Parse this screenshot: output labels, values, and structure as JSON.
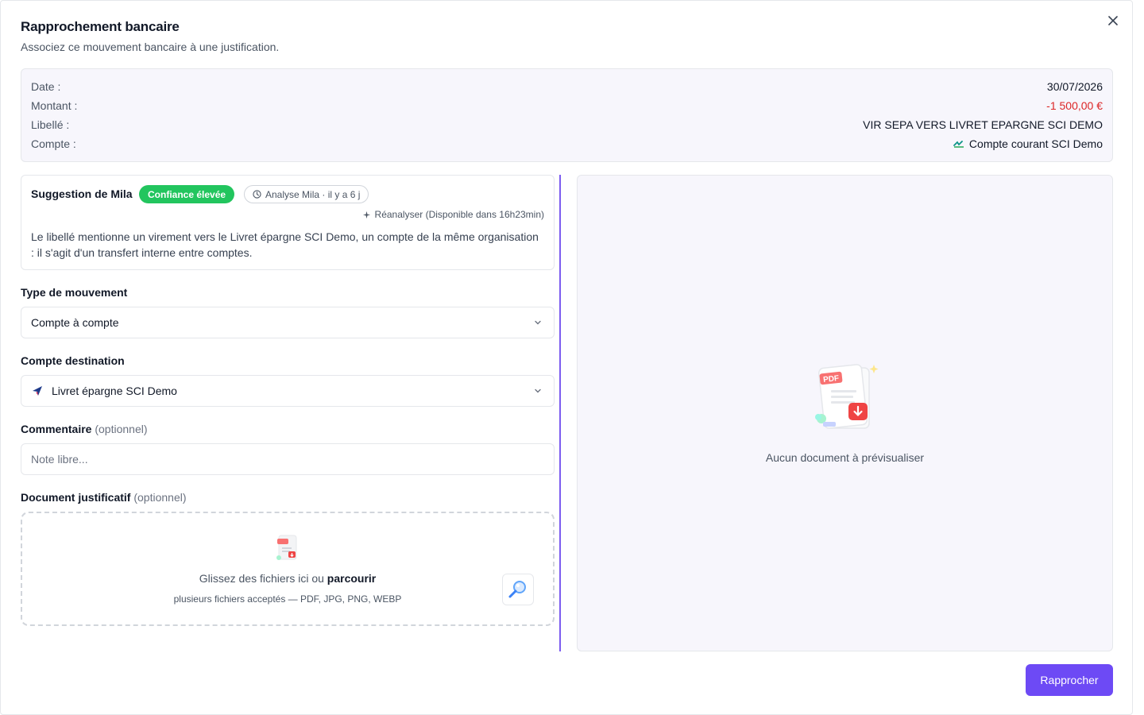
{
  "dialog": {
    "title": "Rapprochement bancaire",
    "subtitle": "Associez ce mouvement bancaire à une justification."
  },
  "summary": {
    "rows": [
      {
        "label": "Date :",
        "value": "30/07/2026"
      },
      {
        "label": "Montant :",
        "value": "-1 500,00 €"
      },
      {
        "label": "Libellé :",
        "value": "VIR SEPA VERS LIVRET EPARGNE SCI DEMO"
      },
      {
        "label": "Compte :",
        "value": "Compte courant SCI Demo"
      }
    ]
  },
  "suggestion": {
    "title": "Suggestion de Mila",
    "confidence_badge": "Confiance élevée",
    "analysis_badge": "Analyse Mila · il y a 6 j",
    "reanalyse": "Réanalyser (Disponible dans 16h23min)",
    "text": "Le libellé mentionne un virement vers le Livret épargne SCI Demo, un compte de la même organisation : il s'agit d'un transfert interne entre comptes."
  },
  "form": {
    "movement_type": {
      "label": "Type de mouvement",
      "value": "Compte à compte"
    },
    "destination": {
      "label": "Compte destination",
      "value": "Livret épargne SCI Demo"
    },
    "comment": {
      "label": "Commentaire",
      "optional": "(optionnel)",
      "placeholder": "Note libre..."
    },
    "document": {
      "label": "Document justificatif",
      "optional": "(optionnel)",
      "drop_text": "Glissez des fichiers ici ou",
      "browse_link": "parcourir",
      "accepted": "plusieurs fichiers acceptés — PDF, JPG, PNG, WEBP"
    }
  },
  "preview": {
    "empty_text": "Aucun document à prévisualiser"
  },
  "actions": {
    "submit_label": "Rapprocher"
  },
  "icons": {
    "close": "close-icon",
    "bank": "bank-logo-icon",
    "clock": "clock-icon",
    "sparkle": "sparkle-icon",
    "chevron": "chevron-down-icon",
    "destination_bank": "destination-bank-logo-icon",
    "pdf": "pdf-document-icon",
    "search": "magnifier-icon"
  },
  "colors": {
    "accent": "#6d4af5",
    "divider": "#7c5cf0",
    "negative": "#dc2626",
    "badge_green": "#22c55e"
  }
}
